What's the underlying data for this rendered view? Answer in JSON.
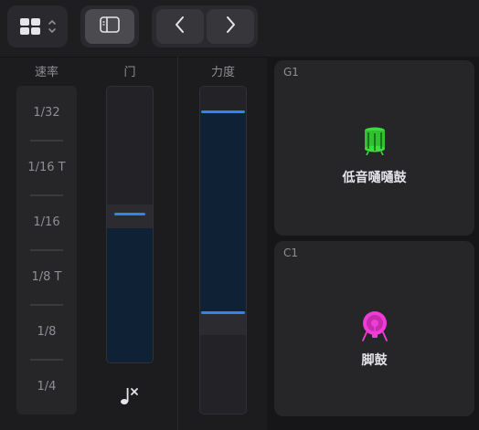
{
  "toolbar": {
    "layout_icon": "grid-layout-icon",
    "updown_icon": "chevron-up-down-icon",
    "sidebar_icon": "sidebar-toggle-icon",
    "prev_icon": "chevron-left-icon",
    "next_icon": "chevron-right-icon"
  },
  "columns": {
    "rate_label": "速率",
    "gate_label": "门",
    "velocity_label": "力度"
  },
  "rate": {
    "items": [
      "1/32",
      "1/16 T",
      "1/16",
      "1/8 T",
      "1/8",
      "1/4"
    ]
  },
  "gate": {
    "level": 0.5,
    "footer_icon": "note-clear-icon"
  },
  "velocity": {
    "max_level": 1.0,
    "min_level": 0.25
  },
  "pads": [
    {
      "note": "G1",
      "name": "低音嗵嗵鼓",
      "icon": "tom-drum-icon",
      "color": "#3ddc3d"
    },
    {
      "note": "C1",
      "name": "脚鼓",
      "icon": "kick-drum-icon",
      "color": "#f03cd6"
    }
  ],
  "colors": {
    "accent": "#2b86f2",
    "background": "#1c1c1e"
  }
}
